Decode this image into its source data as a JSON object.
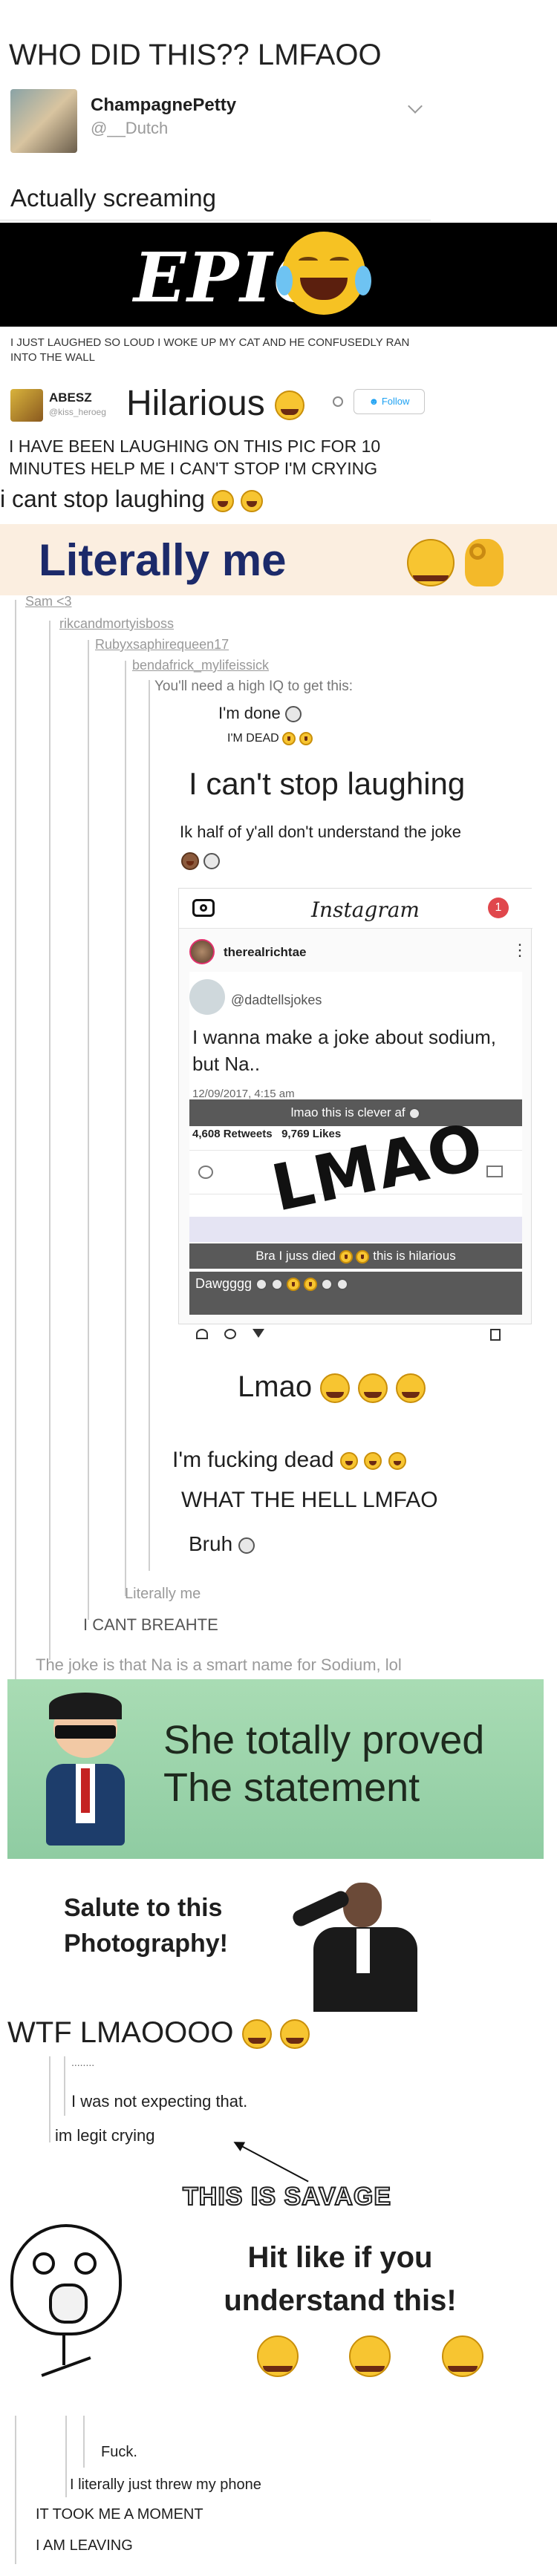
{
  "tweet1": {
    "title": "WHO DID THIS?? LMFAOO",
    "display_name": "ChampagnePetty",
    "handle": "@__Dutch",
    "body": "Actually screaming"
  },
  "epic_banner": {
    "word": "EPIC",
    "caption": "I JUST LAUGHED SO LOUD I WOKE UP MY CAT AND HE CONFUSEDLY RAN INTO THE WALL"
  },
  "tweet2": {
    "display_name": "ABESZ",
    "handle": "@kiss_heroeg",
    "title": "Hilarious",
    "follow_label": "Follow",
    "body": "I HAVE BEEN LAUGHING ON THIS PIC FOR 10 MINUTES HELP ME I CAN'T STOP I'M CRYING",
    "sub": "i cant stop laughing"
  },
  "literally_banner": {
    "text": "Literally me"
  },
  "thread1": {
    "users": [
      "Sam <3",
      "rikcandmortyisboss",
      "Rubyxsaphirequeen17",
      "bendafrick_mylifeissick"
    ],
    "iq_line": "You'll need a high IQ to get this:",
    "done": "I'm done",
    "dead": "I'M DEAD",
    "cant_stop": "I can't stop laughing",
    "half": "Ik half of y'all don't understand the joke"
  },
  "instagram": {
    "app": "Instagram",
    "badge": "1",
    "user": "therealrichtae",
    "inner_handle": "@dadtellsjokes",
    "joke": "I wanna make a joke about sodium, but Na..",
    "date": "12/09/2017, 4:15 am",
    "retweets": "4,608 Retweets",
    "likes": "9,769 Likes",
    "comment1": "lmao this is clever af",
    "stamp": "LMAO",
    "comment2": "Bra I juss died",
    "comment3": "this is hilarious",
    "comment4": "Dawgggg"
  },
  "thread2": {
    "lmao": "Lmao",
    "fucking_dead": "I'm fucking dead",
    "what_the_hell": "WHAT THE HELL LMFAO",
    "bruh": "Bruh",
    "literally": "Literally me",
    "cant_breathe": "I CANT BREAHTE",
    "explain": "The joke is that Na is a smart name for Sodium, lol"
  },
  "proved_banner": {
    "text": "She totally proved The statement"
  },
  "salute": {
    "text": "Salute to this Photography!"
  },
  "thread3": {
    "title": "WTF LMAOOOO",
    "dots": "........",
    "not_expecting": "I was not expecting that.",
    "legit": "im legit crying",
    "savage": "THIS IS SAVAGE",
    "hit_like": "Hit like if you understand this!",
    "fuck": "Fuck.",
    "threw_phone": "I literally just threw my phone",
    "took_me": "IT TOOK ME A MOMENT",
    "leaving": "I AM LEAVING"
  },
  "colors": {
    "twitter_blue": "#1da1f2",
    "literally_bg": "#fbeee0",
    "literally_text": "#1c2a6a",
    "proved_bg": "#9fd4ae",
    "instagram_red": "#e0474c"
  }
}
